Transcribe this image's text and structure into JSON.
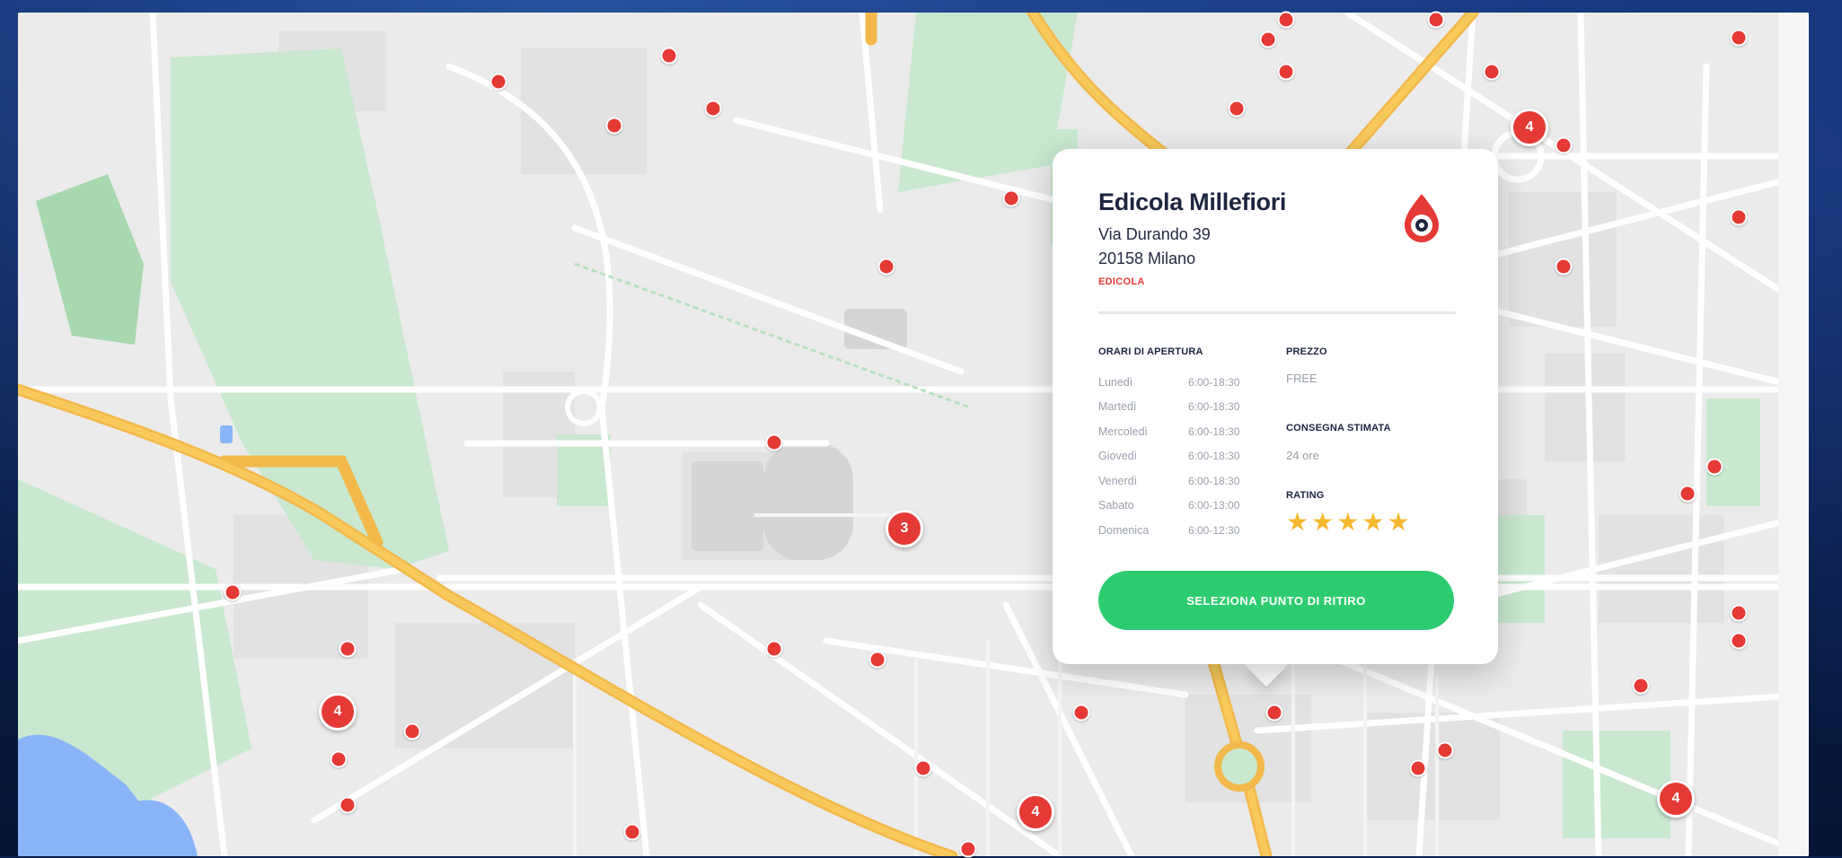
{
  "store": {
    "name": "Edicola Millefiori",
    "address_line1": "Via Durando 39",
    "address_line2": "20158 Milano",
    "category": "EDICOLA"
  },
  "opening_hours": {
    "label": "ORARI DI APERTURA",
    "days": [
      {
        "day": "Lunedì",
        "time": "6:00-18:30"
      },
      {
        "day": "Martedì",
        "time": "6:00-18:30"
      },
      {
        "day": "Mercoledì",
        "time": "6:00-18:30"
      },
      {
        "day": "Giovedì",
        "time": "6:00-18:30"
      },
      {
        "day": "Venerdì",
        "time": "6:00-18:30"
      },
      {
        "day": "Sabato",
        "time": "6:00-13:00"
      },
      {
        "day": "Domenica",
        "time": "6:00-12:30"
      }
    ]
  },
  "price": {
    "label": "PREZZO",
    "value": "FREE"
  },
  "delivery": {
    "label": "CONSEGNA STIMATA",
    "value": "24 ore"
  },
  "rating": {
    "label": "RATING",
    "stars": 5,
    "max": 5
  },
  "button": {
    "label": "SELEZIONA PUNTO DI RITIRO"
  },
  "clusters": [
    "4",
    "3",
    "4",
    "4",
    "4"
  ],
  "colors": {
    "pin": "#e53935",
    "button": "#2ecc71",
    "star": "#f5b82e",
    "road_major": "#f7c95a",
    "park": "#c8e6c9",
    "water": "#8ab4f8"
  },
  "icons": {
    "logo": "droplet-logo-icon",
    "star": "star-icon"
  }
}
